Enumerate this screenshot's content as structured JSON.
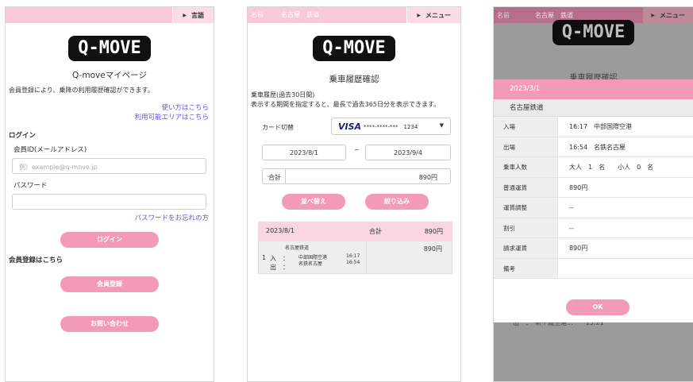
{
  "s1": {
    "lang_label": "言語",
    "logo": "Q-MOVE",
    "title": "Q-moveマイページ",
    "description": "会員登録により、乗降の利用履歴確認ができます。",
    "link_usage": "使い方はこちら",
    "link_area": "利用可能エリアはこちら",
    "login_section": "ログイン",
    "member_id_label": "会員ID(メールアドレス)",
    "member_id_placeholder": "例）example@q-move.jp",
    "password_label": "パスワード",
    "password_value": "",
    "forgot_password": "パスワードをお忘れの方",
    "login_button": "ログイン",
    "register_section": "会員登録はこちら",
    "register_button": "会員登録",
    "contact_button": "お問い合わせ"
  },
  "s2": {
    "name_label": "名前",
    "name_value": "名古屋　鉄道",
    "menu_label": "メニュー",
    "logo": "Q-MOVE",
    "title": "乗車履歴確認",
    "desc_line1": "乗車履歴(過去30日間)",
    "desc_line2": "表示する期間を指定すると、最長で過去365日分を表示できます。",
    "card_label": "カード切替",
    "card_brand": "VISA",
    "card_number": "****-****-***　1234",
    "date_from": "2023/8/1",
    "date_sep": "~",
    "date_to": "2023/9/4",
    "total_label": "合計",
    "total_value": "890円",
    "sort_button": "並べ替え",
    "filter_button": "絞り込み",
    "history": {
      "date": "2023/8/1",
      "total_label": "合計",
      "total_value": "890円",
      "company": "名古屋鉄道",
      "count": "1",
      "in_label": "入　：",
      "in_station": "中部国際空港",
      "in_time": "16:17",
      "out_label": "出　：",
      "out_station": "名鉄名古屋",
      "out_time": "16:54",
      "fare": "890円"
    }
  },
  "s3": {
    "name_label": "名前",
    "name_value": "名古屋　鉄道",
    "menu_label": "メニュー",
    "logo": "Q-MOVE",
    "behind_title": "乗車履歴確認",
    "behind_row": "出　：　新千歳空港...　　15:21",
    "modal": {
      "date": "2023/3/1",
      "company": "名古屋鉄道",
      "rows": [
        {
          "key": "入場",
          "value": "16:17　中部国際空港"
        },
        {
          "key": "出場",
          "value": "16:54　名鉄名古屋"
        },
        {
          "key": "乗車人数",
          "value": "大人　1　名　　小人　0　名"
        },
        {
          "key": "普通運賃",
          "value": "890円"
        },
        {
          "key": "運賃調整",
          "value": "--"
        },
        {
          "key": "割引",
          "value": "--"
        },
        {
          "key": "請求運賃",
          "value": "890円"
        },
        {
          "key": "備考",
          "value": ""
        }
      ],
      "ok_button": "OK"
    }
  },
  "colors": {
    "accent_pink": "#f39ab8",
    "header_pink": "#f9c8d9",
    "link_purple": "#6a4fd6"
  }
}
